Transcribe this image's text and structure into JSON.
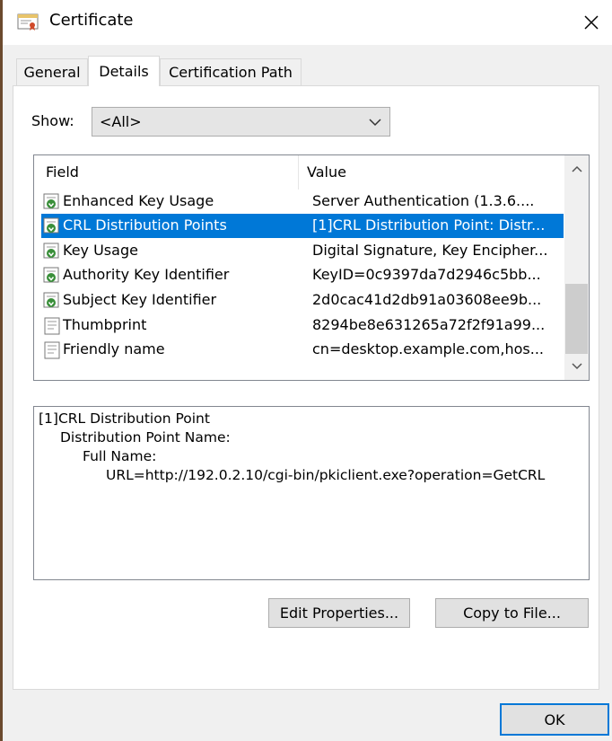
{
  "window": {
    "title": "Certificate"
  },
  "tabs": [
    {
      "label": "General"
    },
    {
      "label": "Details"
    },
    {
      "label": "Certification Path"
    }
  ],
  "show": {
    "label": "Show:",
    "value": "<All>"
  },
  "list": {
    "headers": {
      "field": "Field",
      "value": "Value"
    },
    "rows": [
      {
        "field": "Enhanced Key Usage",
        "value": "Server Authentication (1.3.6....",
        "icon": "certificate-extension-icon"
      },
      {
        "field": "CRL Distribution Points",
        "value": "[1]CRL Distribution Point: Distr...",
        "icon": "certificate-extension-icon",
        "selected": true
      },
      {
        "field": "Key Usage",
        "value": "Digital Signature, Key Encipher...",
        "icon": "certificate-extension-icon"
      },
      {
        "field": "Authority Key Identifier",
        "value": "KeyID=0c9397da7d2946c5bb...",
        "icon": "certificate-extension-icon"
      },
      {
        "field": "Subject Key Identifier",
        "value": "2d0cac41d2db91a03608ee9b...",
        "icon": "certificate-extension-icon"
      },
      {
        "field": "Thumbprint",
        "value": "8294be8e631265a72f2f91a99...",
        "icon": "certificate-property-icon"
      },
      {
        "field": "Friendly name",
        "value": "cn=desktop.example.com,hos...",
        "icon": "certificate-property-icon"
      }
    ]
  },
  "detail": {
    "lines": [
      "[1]CRL Distribution Point",
      "Distribution Point Name:",
      "Full Name:",
      "URL=http://192.0.2.10/cgi-bin/pkiclient.exe?operation=GetCRL"
    ]
  },
  "buttons": {
    "edit_properties": "Edit Properties...",
    "copy_to_file": "Copy to File...",
    "ok": "OK"
  },
  "colors": {
    "selection": "#0078d7",
    "window_bg": "#f0f0f0",
    "panel_bg": "#ffffff"
  }
}
